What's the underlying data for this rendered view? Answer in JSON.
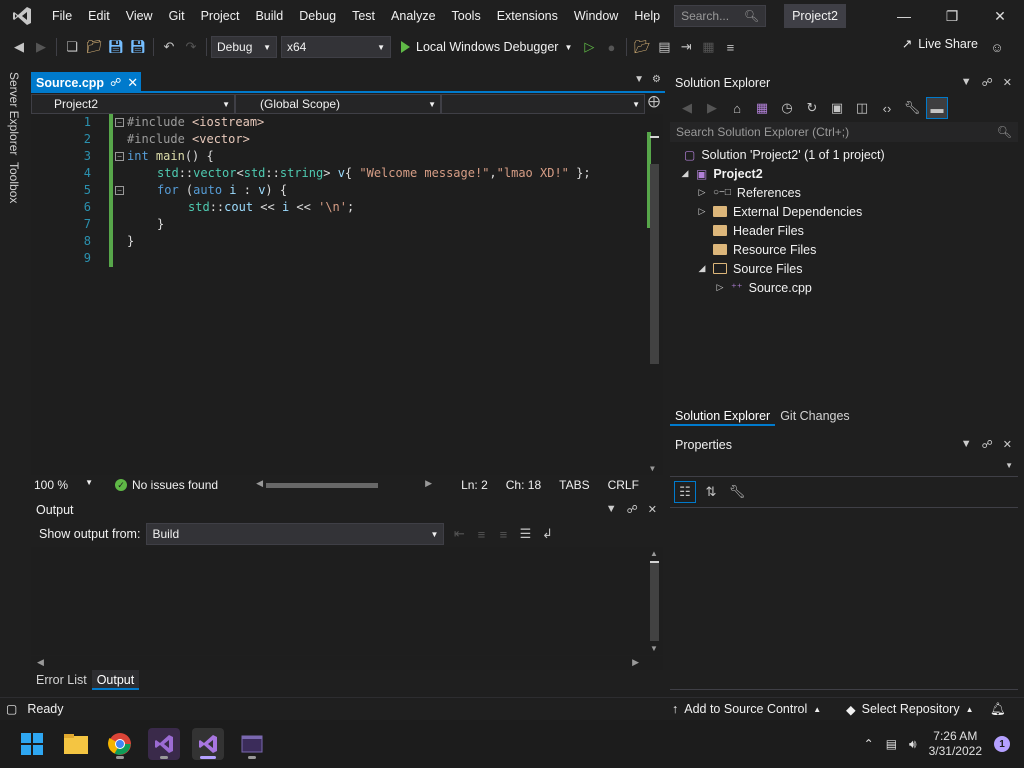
{
  "menu": {
    "items": [
      "File",
      "Edit",
      "View",
      "Git",
      "Project",
      "Build",
      "Debug",
      "Test",
      "Analyze",
      "Tools",
      "Extensions",
      "Window",
      "Help"
    ],
    "search_placeholder": "Search...",
    "project_title": "Project2"
  },
  "toolbar": {
    "config": "Debug",
    "platform": "x64",
    "run_label": "Local Windows Debugger",
    "live_share": "Live Share"
  },
  "left_tabs": {
    "server_explorer": "Server Explorer",
    "toolbox": "Toolbox"
  },
  "editor": {
    "tab_label": "Source.cpp",
    "nav_project": "Project2",
    "nav_scope": "(Global Scope)",
    "nav_member": "",
    "line_numbers": [
      "1",
      "2",
      "3",
      "4",
      "5",
      "6",
      "7",
      "8",
      "9"
    ],
    "code": {
      "l1_directive": "#include ",
      "l1_header": "<iostream>",
      "l2_directive": "#include ",
      "l2_header": "<vector>",
      "l3_kw": "int",
      "l3_fn": " main",
      "l3_rest": "() {",
      "l4_ns1": "std",
      "l4_sep1": "::",
      "l4_type1": "vector",
      "l4_lt": "<",
      "l4_ns2": "std",
      "l4_sep2": "::",
      "l4_type2": "string",
      "l4_gt": "> ",
      "l4_var": "v",
      "l4_brace": "{ ",
      "l4_str1": "\"Welcome message!\"",
      "l4_comma": ",",
      "l4_str2": "\"lmao XD!\"",
      "l4_end": " };",
      "l5_kw1": "for",
      "l5_p1": " (",
      "l5_kw2": "auto",
      "l5_var1": " i",
      "l5_colon": " : ",
      "l5_var2": "v",
      "l5_end": ") {",
      "l6_ns": "std",
      "l6_sep": "::",
      "l6_var": "cout",
      "l6_op1": " << ",
      "l6_var2": "i",
      "l6_op2": " << ",
      "l6_str": "'\\n'",
      "l6_end": ";",
      "l7": "}",
      "l8": "}"
    },
    "zoom": "100 %",
    "issues": "No issues found",
    "ln": "Ln: 2",
    "ch": "Ch: 18",
    "tabs": "TABS",
    "eol": "CRLF"
  },
  "output": {
    "title": "Output",
    "show_from_label": "Show output from:",
    "source": "Build",
    "bottom_tabs": [
      "Error List",
      "Output"
    ],
    "active_tab": "Output"
  },
  "solution_explorer": {
    "title": "Solution Explorer",
    "search_placeholder": "Search Solution Explorer (Ctrl+;)",
    "solution": "Solution 'Project2' (1 of 1 project)",
    "project": "Project2",
    "nodes": [
      "References",
      "External Dependencies",
      "Header Files",
      "Resource Files",
      "Source Files"
    ],
    "file": "Source.cpp",
    "bottom_tabs": [
      "Solution Explorer",
      "Git Changes"
    ]
  },
  "properties": {
    "title": "Properties"
  },
  "statusbar": {
    "ready": "Ready",
    "source_control": "Add to Source Control",
    "repository": "Select Repository"
  },
  "taskbar": {
    "time": "7:26 AM",
    "date": "3/31/2022",
    "notification_count": "1"
  },
  "colors": {
    "accent": "#007acc",
    "keyword": "#569cd6",
    "string": "#d69d85",
    "type": "#4ec9b0",
    "success": "#5fb846"
  }
}
